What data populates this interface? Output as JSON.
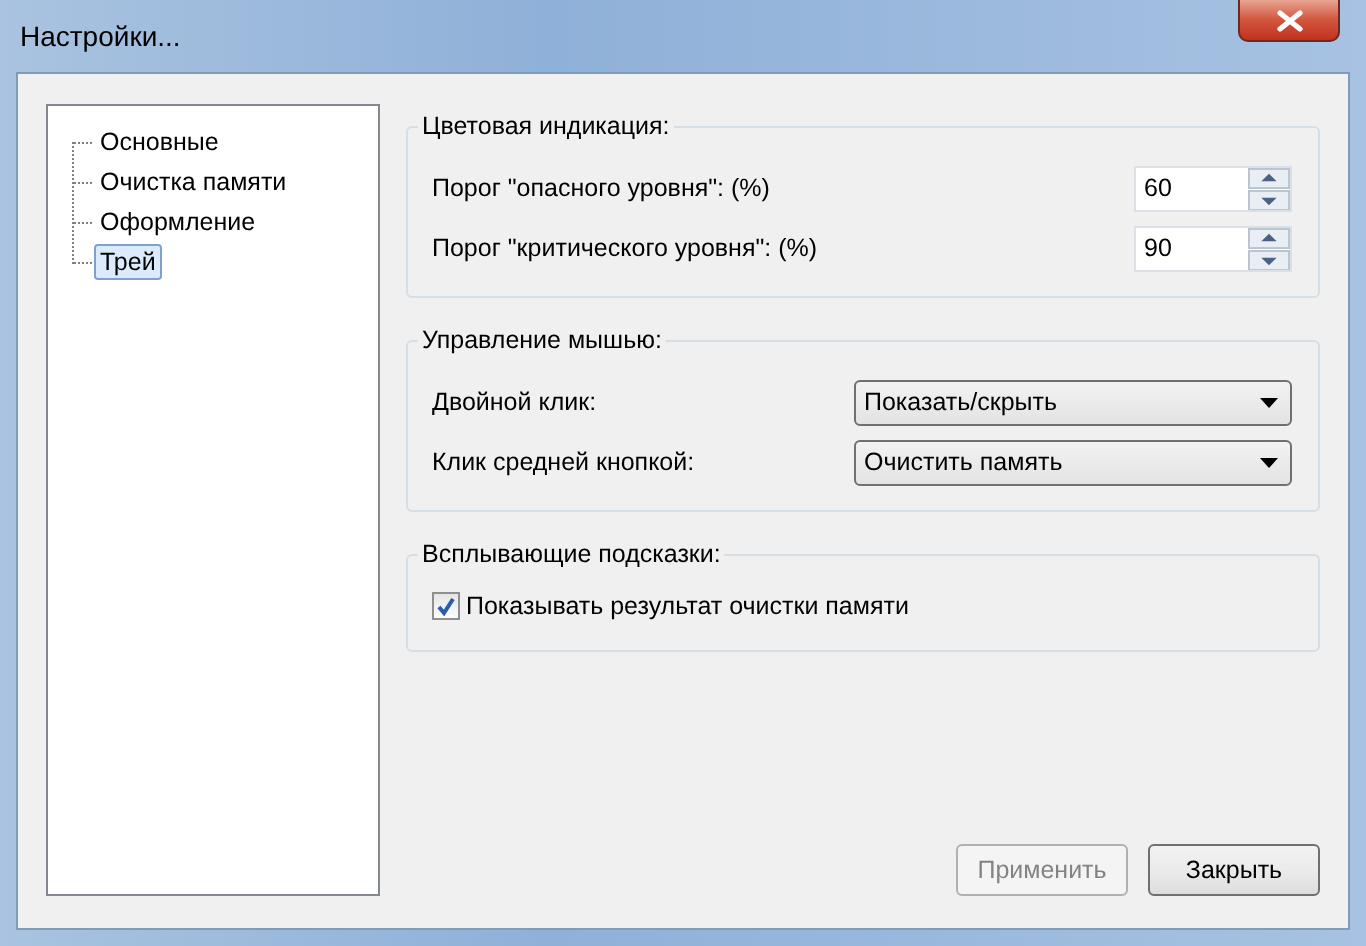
{
  "window": {
    "title": "Настройки..."
  },
  "tree": {
    "items": [
      {
        "label": "Основные",
        "selected": false
      },
      {
        "label": "Очистка памяти",
        "selected": false
      },
      {
        "label": "Оформление",
        "selected": false
      },
      {
        "label": "Трей",
        "selected": true
      }
    ]
  },
  "groups": [
    {
      "title": "Цветовая индикация:",
      "rows": [
        {
          "kind": "spin",
          "label": "Порог \"опасного уровня\": (%)",
          "value": "60"
        },
        {
          "kind": "spin",
          "label": "Порог \"критического уровня\": (%)",
          "value": "90"
        }
      ]
    },
    {
      "title": "Управление мышью:",
      "rows": [
        {
          "kind": "combo",
          "label": "Двойной клик:",
          "value": "Показать/скрыть"
        },
        {
          "kind": "combo",
          "label": "Клик средней кнопкой:",
          "value": "Очистить память"
        }
      ]
    },
    {
      "title": "Всплывающие подсказки:",
      "rows": [
        {
          "kind": "check",
          "label": "Показывать результат очистки памяти",
          "checked": true
        }
      ]
    }
  ],
  "buttons": [
    {
      "label": "Применить",
      "disabled": true
    },
    {
      "label": "Закрыть",
      "disabled": false
    }
  ]
}
